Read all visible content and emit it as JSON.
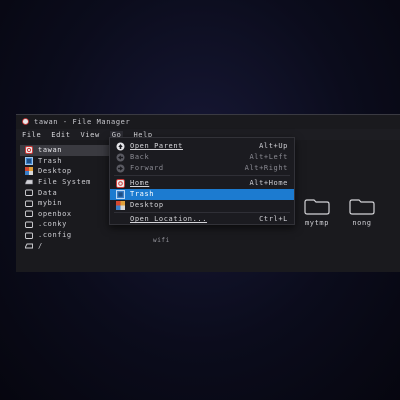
{
  "window": {
    "title": "tawan - File Manager"
  },
  "menubar": {
    "file": "File",
    "edit": "Edit",
    "view": "View",
    "go": "Go",
    "help": "Help"
  },
  "sidebar": {
    "items": [
      {
        "label": "tawan",
        "icon": "home-icon"
      },
      {
        "label": "Trash",
        "icon": "trash-icon"
      },
      {
        "label": "Desktop",
        "icon": "desktop-icon"
      },
      {
        "label": "File System",
        "icon": "drive-icon"
      },
      {
        "label": "Data",
        "icon": "folder-icon"
      },
      {
        "label": "mybin",
        "icon": "folder-icon"
      },
      {
        "label": "openbox",
        "icon": "folder-icon"
      },
      {
        "label": ".conky",
        "icon": "folder-icon"
      },
      {
        "label": ".config",
        "icon": "folder-icon"
      },
      {
        "label": "/",
        "icon": "folder-icon"
      }
    ]
  },
  "content": {
    "folders": [
      "mytmp",
      "nong"
    ],
    "partial_label": "wifi"
  },
  "go_menu": {
    "open_parent": {
      "label": "Open Parent",
      "shortcut": "Alt+Up"
    },
    "back": {
      "label": "Back",
      "shortcut": "Alt+Left"
    },
    "forward": {
      "label": "Forward",
      "shortcut": "Alt+Right"
    },
    "home": {
      "label": "Home",
      "shortcut": "Alt+Home"
    },
    "trash": {
      "label": "Trash"
    },
    "desktop": {
      "label": "Desktop"
    },
    "open_location": {
      "label": "Open Location...",
      "shortcut": "Ctrl+L"
    }
  },
  "colors": {
    "highlight": "#1c7bd0",
    "background": "#0b0c1c",
    "window": "#1a1a1e"
  }
}
